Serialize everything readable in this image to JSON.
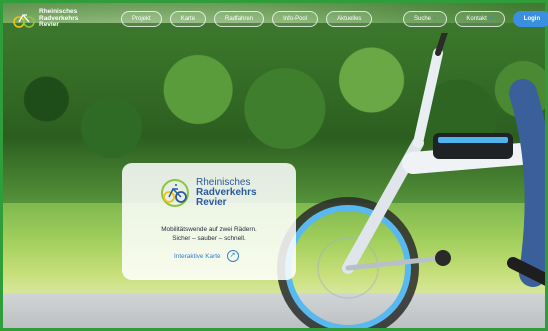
{
  "header": {
    "logo": {
      "lines": [
        "Rheinisches",
        "Radverkehrs",
        "Revier"
      ]
    },
    "nav": [
      {
        "label": "Projekt"
      },
      {
        "label": "Karte"
      },
      {
        "label": "Radfahren"
      },
      {
        "label": "Info-Pool"
      },
      {
        "label": "Aktuelles"
      }
    ],
    "search": {
      "label": "Suche",
      "icon": "search-icon"
    },
    "contact": {
      "label": "Kontakt",
      "icon": "phone-icon"
    },
    "login": {
      "label": "Login"
    }
  },
  "hero": {
    "logo_lines": [
      "Rheinisches",
      "Radverkehrs",
      "Revier"
    ],
    "tagline_1": "Mobilitätswende auf zwei Rädern.",
    "tagline_2": "Sicher – sauber – schnell.",
    "map_link": "Interaktive Karte",
    "map_icon": "arrow-up-right-icon"
  },
  "colors": {
    "accent": "#3a8fe0",
    "brand_blue": "#2a5a9e",
    "brand_green": "#8bc53f",
    "brand_yellow": "#f2c21a"
  }
}
